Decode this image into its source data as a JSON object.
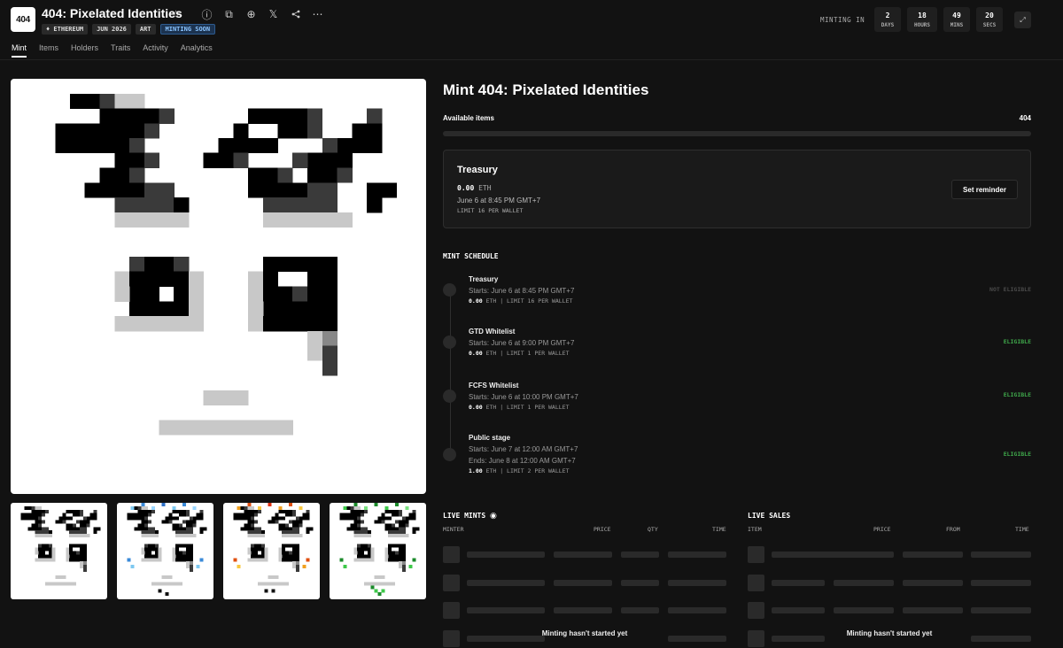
{
  "header": {
    "logo": "404",
    "title": "404: Pixelated Identities",
    "badges": [
      "♦ ETHEREUM",
      "JUN 2026",
      "ART",
      "MINTING SOON"
    ],
    "tabs": [
      "Mint",
      "Items",
      "Holders",
      "Traits",
      "Activity",
      "Analytics"
    ],
    "icons": [
      "star-icon",
      "info-icon",
      "copy-icon",
      "globe-icon",
      "x-icon",
      "share-icon",
      "more-icon"
    ],
    "minting_in": "MINTING IN",
    "countdown": [
      {
        "value": "2",
        "label": "DAYS"
      },
      {
        "value": "18",
        "label": "HOURS"
      },
      {
        "value": "49",
        "label": "MINS"
      },
      {
        "value": "20",
        "label": "SECS"
      }
    ]
  },
  "main": {
    "title": "Mint 404: Pixelated Identities",
    "available_label": "Available items",
    "available_count": "404",
    "treasury": {
      "title": "Treasury",
      "price": "0.00",
      "currency": "ETH",
      "date": "June 6 at 8:45 PM GMT+7",
      "limit": "LIMIT 16 PER WALLET",
      "button": "Set reminder"
    },
    "schedule_title": "MINT SCHEDULE",
    "schedule": [
      {
        "name": "Treasury",
        "line1": "Starts: June 6 at 8:45 PM GMT+7",
        "line2": "",
        "price": "0.00",
        "meta": "ETH | LIMIT 16 PER WALLET",
        "status": "NOT ELIGIBLE"
      },
      {
        "name": "GTD Whitelist",
        "line1": "Starts: June 6 at 9:00 PM GMT+7",
        "line2": "",
        "price": "0.00",
        "meta": "ETH | LIMIT 1 PER WALLET",
        "status": "ELIGIBLE"
      },
      {
        "name": "FCFS Whitelist",
        "line1": "Starts: June 6 at 10:00 PM GMT+7",
        "line2": "",
        "price": "0.00",
        "meta": "ETH | LIMIT 1 PER WALLET",
        "status": "ELIGIBLE"
      },
      {
        "name": "Public stage",
        "line1": "Starts: June 7 at 12:00 AM GMT+7",
        "line2": "Ends: June 8 at 12:00 AM GMT+7",
        "price": "1.00",
        "meta": "ETH | LIMIT 2 PER WALLET",
        "status": "ELIGIBLE"
      }
    ],
    "live_mints": {
      "title": "LIVE MINTS",
      "columns": [
        "MINTER",
        "PRICE",
        "QTY",
        "TIME"
      ],
      "empty": "Minting hasn't started yet"
    },
    "live_sales": {
      "title": "LIVE SALES",
      "columns": [
        "ITEM",
        "PRICE",
        "FROM",
        "TIME"
      ],
      "empty": "Minting hasn't started yet"
    }
  },
  "colors": {
    "background": "#121212",
    "eligible": "#3fa84b",
    "not_eligible": "#4a4a4a",
    "badge_soon": "#8ac4ff"
  }
}
